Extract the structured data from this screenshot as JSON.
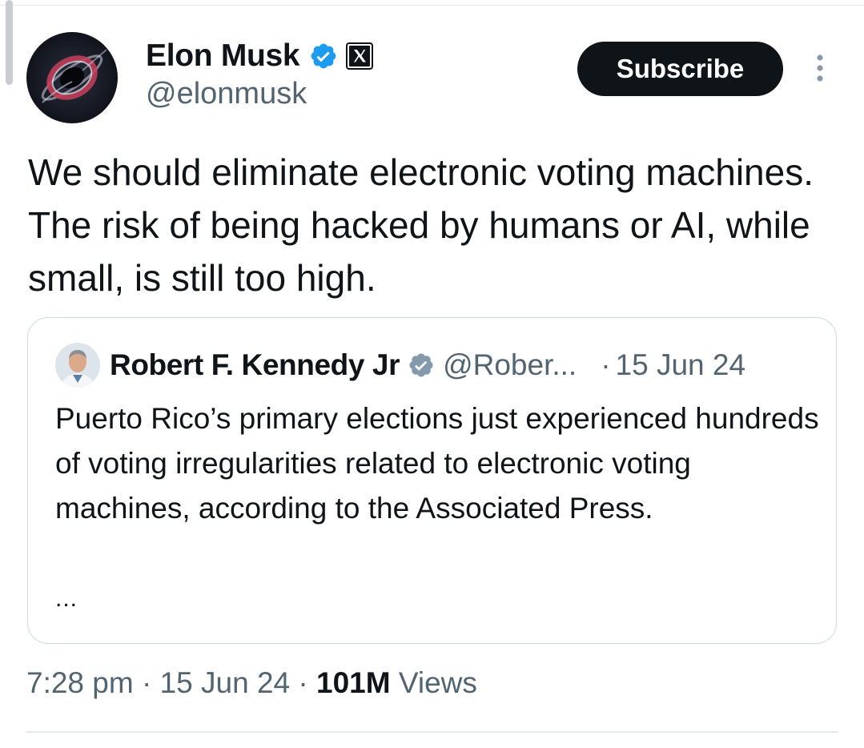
{
  "tweet": {
    "author": {
      "name": "Elon Musk",
      "handle": "@elonmusk",
      "avatar": "black-hole-avatar",
      "verified_icon": "verified-badge-icon",
      "affiliation_icon": "x-logo-icon"
    },
    "subscribe_label": "Subscribe",
    "more_icon": "more-vertical-icon",
    "text": "We should eliminate electronic voting machines. The risk of being hacked by humans or AI, while small, is still too high.",
    "quoted": {
      "author_name": "Robert F. Kennedy Jr",
      "handle": "@Rober...",
      "separator": "·",
      "date": "15 Jun 24",
      "text": "Puerto Rico’s primary elections just experienced hundreds of voting irregularities related to electronic voting machines, according to the Associated Press.",
      "ellipsis": "...",
      "verified_icon": "verified-badge-icon"
    },
    "meta": {
      "time": "7:28 pm",
      "separator1": " · ",
      "date": "15 Jun 24",
      "separator2": " · ",
      "views_count": "101M",
      "views_label": "Views"
    }
  },
  "colors": {
    "text": "#0f1419",
    "secondary": "#536471",
    "verified_blue": "#1d9bf0",
    "quote_verified_gray": "#829aab",
    "button_bg": "#0f1419",
    "border": "#cfd9de"
  }
}
